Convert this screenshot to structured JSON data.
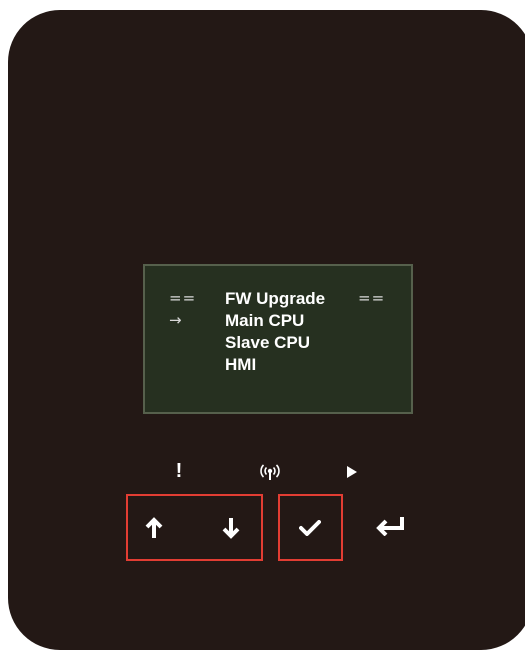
{
  "screen": {
    "title_marker_left": "==",
    "title": "FW Upgrade",
    "title_marker_right": "==",
    "selection_cursor": "→",
    "menu_items": [
      {
        "label": "Main CPU",
        "selected": true
      },
      {
        "label": "Slave CPU",
        "selected": false
      },
      {
        "label": "HMI",
        "selected": false
      }
    ]
  },
  "indicators": [
    {
      "name": "alarm",
      "icon": "exclamation-icon",
      "glyph": "!"
    },
    {
      "name": "communication",
      "icon": "wireless-signal-icon"
    },
    {
      "name": "run",
      "icon": "play-icon"
    }
  ],
  "buttons": [
    {
      "name": "up",
      "icon": "arrow-up-icon",
      "highlighted": true
    },
    {
      "name": "down",
      "icon": "arrow-down-icon",
      "highlighted": true
    },
    {
      "name": "enter",
      "icon": "checkmark-icon",
      "highlighted": true
    },
    {
      "name": "back",
      "icon": "return-arrow-icon",
      "highlighted": false
    }
  ],
  "colors": {
    "panel": "#231815",
    "lcd_background": "#263020",
    "highlight_border": "#e23d33",
    "foreground": "#ffffff"
  }
}
